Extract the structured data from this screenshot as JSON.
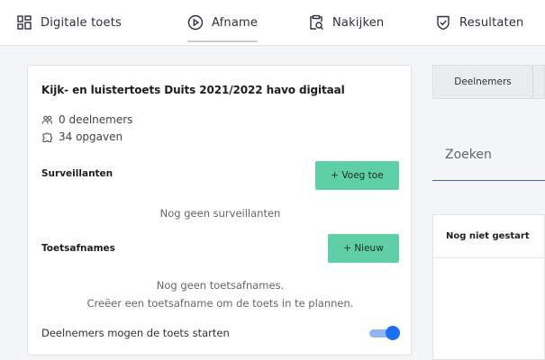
{
  "nav": {
    "items": [
      {
        "label": "Digitale toets",
        "icon": "grid-icon"
      },
      {
        "label": "Afname",
        "icon": "play-circle-icon"
      },
      {
        "label": "Nakijken",
        "icon": "clipboard-search-icon"
      },
      {
        "label": "Resultaten",
        "icon": "check-shield-icon"
      }
    ],
    "active": "Afname"
  },
  "card": {
    "title": "Kijk- en luistertoets Duits 2021/2022 havo digitaal",
    "participants": "0 deelnemers",
    "questions": "34 opgaven",
    "surveillants": {
      "label": "Surveillanten",
      "button": "+ Voeg toe",
      "empty": "Nog geen surveillanten"
    },
    "sessions": {
      "label": "Toetsafnames",
      "button": "+ Nieuw",
      "empty_line1": "Nog geen toetsafnames.",
      "empty_line2": "Creëer een toetsafname om de toets in te plannen."
    },
    "start_toggle": {
      "label": "Deelnemers mogen de toets starten",
      "on": true
    }
  },
  "right": {
    "tab": "Deelnemers",
    "search_placeholder": "Zoeken",
    "status_header": "Nog niet gestart"
  },
  "colors": {
    "accent_green": "#5fcfa8",
    "toggle_blue": "#1d6ff2",
    "search_underline": "#2f6ad6"
  }
}
